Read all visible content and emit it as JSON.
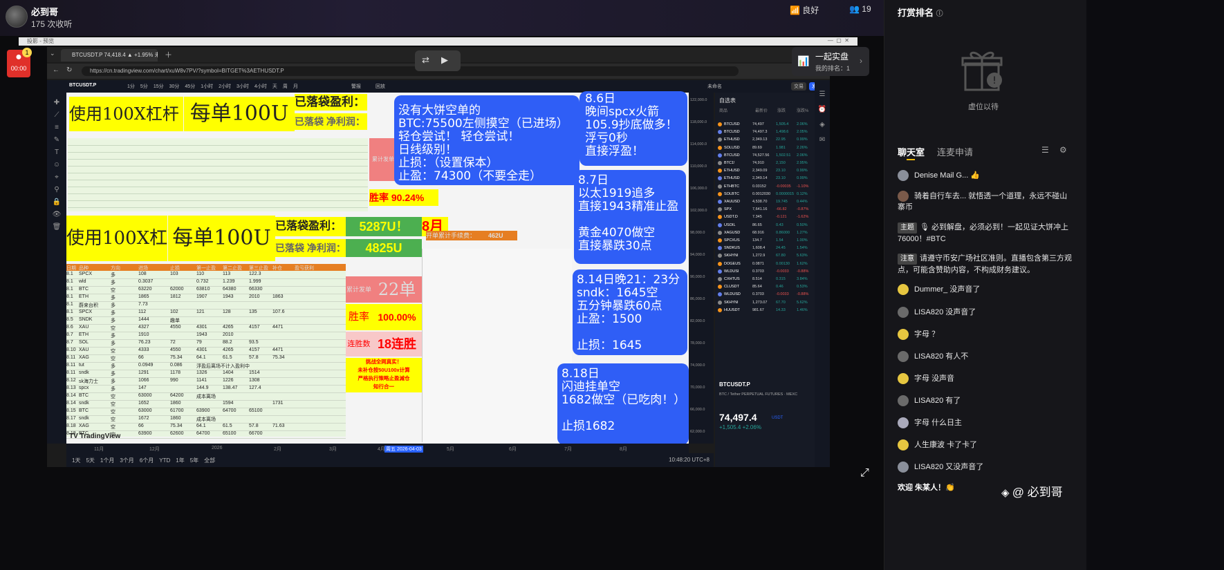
{
  "header": {
    "host_name": "必到哥",
    "listen_count": "175 次收听",
    "network": "良好",
    "viewers": "19"
  },
  "capture": {
    "title": "投影 - 预览",
    "rec_time": "00:00",
    "rec_badge": "1"
  },
  "browser": {
    "tab_title": "BTCUSDT.P 74,418.4 ▲ +1.95% 未…",
    "url": "https://cn.tradingview.com/chart/xuW8v7PV/?symbol=BITGET%3AETHUSDT.P"
  },
  "toolbar": {
    "symbol": "BTCUSDT.P",
    "intervals": [
      "1分",
      "5分",
      "15分",
      "30分",
      "45分",
      "1小时",
      "2小时",
      "3小时",
      "4小时",
      "天",
      "周",
      "月"
    ],
    "alert": "警报",
    "replay": "回放",
    "trade": "交易",
    "publish": "发布",
    "unnamed": "未命名"
  },
  "overlay": {
    "live_title": "一起实盘",
    "live_rank": "我的排名：1"
  },
  "sheet": {
    "top_banner_a": "使用100X杠杆",
    "top_banner_b": "每单100U",
    "profit_label": "已落袋盈利：",
    "net_label": "已落袋 净利润：",
    "banner_a": "使用100X杠杆",
    "banner_b": "每单100U",
    "profit_label2": "已落袋盈利：",
    "profit_value2": "5287U！",
    "month": "8月",
    "net_label2": "已落袋 净利润：",
    "net_value2": "4825U",
    "fee_label": "开单累计手续费：",
    "fee_value": "462U",
    "win_rate_top": "90.24%",
    "win_label_top": "胜率",
    "orders_label": "累计发单",
    "orders_value": "22单",
    "win_label": "胜率",
    "win_value": "100.00%",
    "streak_label": "连胜数",
    "streak_value": "18连胜",
    "challenge": [
      "挑战全网真实！",
      "未补仓按50U100x计算",
      "严格执行策略止盈減仓",
      "知行合一"
    ],
    "col_headers": [
      "日期",
      "品种",
      "方向",
      "进场",
      "止损",
      "第一止盈",
      "第二止盈",
      "第三止盈",
      "补仓",
      "盈亏获利"
    ],
    "rows": [
      [
        "8.1",
        "SPCX",
        "多",
        "108",
        "103",
        "110",
        "113",
        "122.3",
        ""
      ],
      [
        "8.1",
        "wld",
        "多",
        "0.3037",
        "",
        "0.732",
        "1.239",
        "1.999",
        ""
      ],
      [
        "8.1",
        "BTC",
        "空",
        "63220",
        "62000",
        "63810",
        "64380",
        "66330",
        ""
      ],
      [
        "8.1",
        "ETH",
        "多",
        "1865",
        "1812",
        "1907",
        "1943",
        "2010",
        "1863"
      ],
      [
        "8.1",
        "蔚来台积",
        "多",
        "7.73",
        "",
        "",
        "",
        "",
        ""
      ],
      [
        "8.1",
        "SPCX",
        "多",
        "112",
        "102",
        "121",
        "128",
        "135",
        "107.6"
      ],
      [
        "8.5",
        "SNDK",
        "多",
        "1444",
        "趣单",
        "",
        "",
        "",
        ""
      ],
      [
        "8.6",
        "XAU",
        "空",
        "4327",
        "4550",
        "4301",
        "4265",
        "4157",
        "4471"
      ],
      [
        "8.7",
        "ETH",
        "多",
        "1910",
        "",
        "1943",
        "2010",
        "",
        ""
      ],
      [
        "8.7",
        "SOL",
        "多",
        "76.23",
        "72",
        "79",
        "88.2",
        "93.5",
        ""
      ],
      [
        "8.10",
        "XAU",
        "空",
        "4333",
        "4550",
        "4301",
        "4265",
        "4157",
        "4471"
      ],
      [
        "8.11",
        "XAG",
        "空",
        "66",
        "75.34",
        "64.1",
        "61.5",
        "57.8",
        "75.34"
      ],
      [
        "8.11",
        "tut",
        "多",
        "0.0949",
        "0.086",
        "浮盈后离场不计入盈利中",
        "",
        "",
        ""
      ],
      [
        "8.11",
        "sndk",
        "多",
        "1291",
        "1178",
        "1326",
        "1404",
        "1514",
        ""
      ],
      [
        "8.12",
        "sk海力士",
        "多",
        "1066",
        "990",
        "1141",
        "1226",
        "1308",
        ""
      ],
      [
        "8.13",
        "spcx",
        "多",
        "147",
        "",
        "144.9",
        "138.47",
        "127.4",
        ""
      ],
      [
        "8.14",
        "BTC",
        "空",
        "63000",
        "64200",
        "成本离场",
        "",
        "",
        ""
      ],
      [
        "8.14",
        "sndk",
        "空",
        "1652",
        "1860",
        "",
        "1594",
        "",
        "1731"
      ],
      [
        "8.15",
        "BTC",
        "空",
        "63000",
        "61700",
        "63900",
        "64700",
        "65100",
        ""
      ],
      [
        "8.17",
        "sndk",
        "空",
        "1672",
        "1860",
        "成本离场",
        "",
        "",
        ""
      ],
      [
        "8.18",
        "XAG",
        "空",
        "66",
        "75.34",
        "64.1",
        "61.5",
        "57.8",
        "71.63"
      ],
      [
        "8.18",
        "BTC",
        "空",
        "63900",
        "62600",
        "64700",
        "65100",
        "66700",
        ""
      ]
    ]
  },
  "notes": {
    "n1": [
      "没有大饼空单的",
      "BTC:75500左侧摸空（已进场）",
      "轻仓尝试！ 轻仓尝试！",
      "日线级别！",
      "止损：（设置保本）",
      "止盈：74300（不要全走）"
    ],
    "n2": [
      "8.6日",
      "晚间spcx火箭",
      "105.9抄底做多！",
      "浮亏0秒",
      "直接浮盈！"
    ],
    "n3": [
      "8.7日",
      "以太1919追多",
      "直接1943精准止盈",
      "",
      "黄金4070做空",
      "直接暴跌30点"
    ],
    "n4": [
      "8.14日晚21：23分",
      "sndk：1645空",
      "五分钟暴跌60点",
      "止盈：1500",
      "",
      "止损：1645"
    ],
    "n5": [
      "8.18日",
      "闪迪挂单空",
      "1682做空（已吃肉！）",
      "",
      "止损1682"
    ]
  },
  "time_axis": [
    "11月",
    "12月",
    "2026",
    "2月",
    "3月",
    "4月",
    "周五 2026-04-03",
    "5月",
    "6月",
    "7月",
    "8月"
  ],
  "range_buttons": [
    "1天",
    "5天",
    "1个月",
    "3个月",
    "6个月",
    "YTD",
    "1年",
    "5年",
    "全部"
  ],
  "clock": "10:48:20 UTC+8",
  "price_ticks": [
    "122,000.0",
    "118,000.0",
    "114,000.0",
    "110,000.0",
    "106,000.0",
    "102,000.0",
    "98,000.0",
    "94,000.0",
    "90,000.0",
    "86,000.0",
    "82,000.0",
    "78,000.0",
    "74,000.0",
    "70,000.0",
    "66,000.0",
    "62,000.0"
  ],
  "watchlist": {
    "title": "自选表",
    "headers": [
      "商品",
      "最新价",
      "涨跌",
      "涨跌%"
    ],
    "items": [
      [
        "BTCUSD",
        "74,497",
        "1,505.4",
        "2.06%"
      ],
      [
        "BTCUSD",
        "74,497.3",
        "1,498.6",
        "2.05%"
      ],
      [
        "ETHUSD",
        "2,349.13",
        "22.95",
        "0.99%"
      ],
      [
        "SOLUSD",
        "89.69",
        "1.981",
        "2.26%"
      ],
      [
        "BTCUSD",
        "74,527.56",
        "1,502.51",
        "2.06%"
      ],
      [
        "BTC1!",
        "74,910",
        "2,150",
        "2.95%"
      ],
      [
        "ETHUSD",
        "2,349.09",
        "23.10",
        "0.99%"
      ],
      [
        "ETHUSD",
        "2,349.14",
        "23.10",
        "0.99%"
      ],
      [
        "ETHBTC",
        "0.03152",
        "-0.00035",
        "-1.10%"
      ],
      [
        "SOLBTC",
        "0.0012030",
        "0.0000015",
        "0.12%"
      ],
      [
        "XAUUSD",
        "4,538.70",
        "19.745",
        "0.44%"
      ],
      [
        "SPX",
        "7,641.16",
        "-66.82",
        "-0.87%"
      ],
      [
        "USDT.D",
        "7.345",
        "-0.121",
        "-1.62%"
      ],
      [
        "USOIL",
        "86.65",
        "0.43",
        "0.50%"
      ],
      [
        "XAGUSD",
        "68.916",
        "0.86000",
        "1.27%"
      ],
      [
        "SPCXUS",
        "134.7",
        "1.54",
        "1.00%"
      ],
      [
        "SNDKUS",
        "1,608.4",
        "24.45",
        "1.54%"
      ],
      [
        "SKHYNI",
        "1,272.9",
        "67.80",
        "5.63%"
      ],
      [
        "DOGEUS",
        "0.0871",
        "0.00130",
        "1.62%"
      ],
      [
        "WLDUSI",
        "0.3703",
        "-0.0033",
        "-0.88%"
      ],
      [
        "CXHTUS",
        "8.514",
        "0.315",
        "3.84%"
      ],
      [
        "CLUSDT",
        "85.64",
        "0.46",
        "0.53%"
      ],
      [
        "WLDUSD",
        "0.3703",
        "-0.0033",
        "-0.88%"
      ],
      [
        "SKHYNI",
        "1,273.07",
        "67.70",
        "5.62%"
      ],
      [
        "HUUSDT",
        "981.67",
        "14.33",
        "1.46%"
      ]
    ],
    "detail_symbol": "BTCUSDT.P",
    "detail_desc": "BTC / Tether PERPETUAL FUTURES · MEXC",
    "detail_price": "74,497.4",
    "detail_change": "+1,505.4 +2.06%",
    "detail_unit": "USDT"
  },
  "right_panel": {
    "rank_title": "打赏排名",
    "rank_empty": "虚位以待",
    "tab_chat": "聊天室",
    "tab_link": "连麦申请",
    "messages": [
      {
        "user": "Denise Mail G...",
        "text": "👍"
      },
      {
        "user": "骑着自行车去...",
        "text": "就悟透一个道理，永远不碰山寨币"
      },
      {
        "tag": "主题",
        "text": "🎙 必到解盘，必须必到！一起见证大饼冲上76000！#BTC"
      },
      {
        "tag": "注意",
        "text": "请遵守币安广场社区准则。直播包含第三方观点，可能含赞助内容，不构成财务建议。"
      },
      {
        "user": "Dummer_",
        "text": "没声音了"
      },
      {
        "user": "LISA820",
        "text": "没声音了"
      },
      {
        "user": "字母",
        "text": "？"
      },
      {
        "user": "LISA820",
        "text": "有人不"
      },
      {
        "user": "字母",
        "text": "没声音"
      },
      {
        "user": "LISA820",
        "text": "有了"
      },
      {
        "user": "字母",
        "text": "什么日主"
      },
      {
        "user": "人生康波",
        "text": "卡了卡了"
      },
      {
        "user": "LISA820",
        "text": "又没声音了"
      }
    ],
    "welcome": "欢迎 朱某人！👏",
    "watermark": "@ 必到哥"
  },
  "colors": {
    "accent_blue": "#2f5ef6",
    "banner_yellow": "#ffff00",
    "price_green": "#26a69a",
    "price_red": "#ef5350"
  }
}
